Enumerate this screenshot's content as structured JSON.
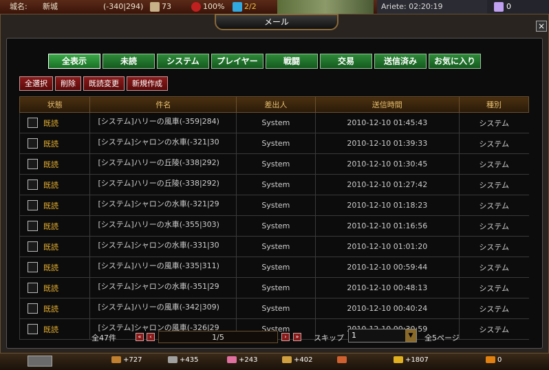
{
  "header": {
    "city_label": "城名:",
    "city_name": "新城",
    "coords": "(-340|294)",
    "population": "73",
    "morale": "100%",
    "flags": "2/2",
    "server_time": "Ariete: 02:20:19",
    "gems": "0"
  },
  "window": {
    "title": "メール",
    "close": "×"
  },
  "tabs": [
    {
      "label": "全表示"
    },
    {
      "label": "未読"
    },
    {
      "label": "システム"
    },
    {
      "label": "プレイヤー"
    },
    {
      "label": "戦闘"
    },
    {
      "label": "交易"
    },
    {
      "label": "送信済み"
    },
    {
      "label": "お気に入り"
    }
  ],
  "actions": {
    "select_all": "全選択",
    "delete": "削除",
    "change_read": "既読変更",
    "compose": "新規作成"
  },
  "table": {
    "headers": [
      "状態",
      "件名",
      "差出人",
      "送信時間",
      "種別"
    ],
    "rows": [
      {
        "status": "既読",
        "subject": "[システム]ハリーの風車(-359|284)",
        "sender": "System",
        "time": "2010-12-10 01:45:43",
        "type": "システム"
      },
      {
        "status": "既読",
        "subject": "[システム]シャロンの水車(-321|30",
        "sender": "System",
        "time": "2010-12-10 01:39:33",
        "type": "システム"
      },
      {
        "status": "既読",
        "subject": "[システム]ハリーの丘陵(-338|292)",
        "sender": "System",
        "time": "2010-12-10 01:30:45",
        "type": "システム"
      },
      {
        "status": "既読",
        "subject": "[システム]ハリーの丘陵(-338|292)",
        "sender": "System",
        "time": "2010-12-10 01:27:42",
        "type": "システム"
      },
      {
        "status": "既読",
        "subject": "[システム]シャロンの水車(-321|29",
        "sender": "System",
        "time": "2010-12-10 01:18:23",
        "type": "システム"
      },
      {
        "status": "既読",
        "subject": "[システム]ハリーの水車(-355|303)",
        "sender": "System",
        "time": "2010-12-10 01:16:56",
        "type": "システム"
      },
      {
        "status": "既読",
        "subject": "[システム]シャロンの水車(-331|30",
        "sender": "System",
        "time": "2010-12-10 01:01:20",
        "type": "システム"
      },
      {
        "status": "既読",
        "subject": "[システム]ハリーの風車(-335|311)",
        "sender": "System",
        "time": "2010-12-10 00:59:44",
        "type": "システム"
      },
      {
        "status": "既読",
        "subject": "[システム]シャロンの水車(-351|29",
        "sender": "System",
        "time": "2010-12-10 00:48:13",
        "type": "システム"
      },
      {
        "status": "既読",
        "subject": "[システム]ハリーの風車(-342|309)",
        "sender": "System",
        "time": "2010-12-10 00:40:24",
        "type": "システム"
      },
      {
        "status": "既読",
        "subject": "[システム]シャロンの風車(-326|29",
        "sender": "System",
        "time": "2010-12-10 00:30:59",
        "type": "システム"
      }
    ]
  },
  "pager": {
    "total": "全47件",
    "page": "1/5",
    "skip_label": "スキップ",
    "skip_value": "1",
    "total_pages": "全5ページ"
  },
  "resources": [
    "+727",
    "+435",
    "+243",
    "+402",
    "+1807",
    "0"
  ],
  "colors": {
    "tab_green": "#2e8a3a",
    "action_red": "#8a1a1a",
    "header_gold": "#e8c070",
    "read_status": "#e8b030"
  }
}
